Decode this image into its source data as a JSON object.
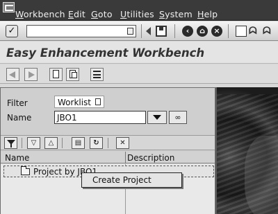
{
  "menubar": {
    "items": [
      "Workbench",
      "Edit",
      "Goto",
      "Utilities",
      "System",
      "Help"
    ]
  },
  "toolbar": {
    "command_value": ""
  },
  "title": "Easy Enhancement Workbench",
  "filter_panel": {
    "filter_label": "Filter",
    "filter_value": "Worklist",
    "name_label": "Name",
    "name_value": "JBO1"
  },
  "tree": {
    "columns": [
      "Name",
      "Description"
    ],
    "rows": [
      {
        "name": "Project by JBO1",
        "description": ""
      }
    ]
  },
  "context_menu": {
    "items": [
      "Create Project"
    ]
  }
}
